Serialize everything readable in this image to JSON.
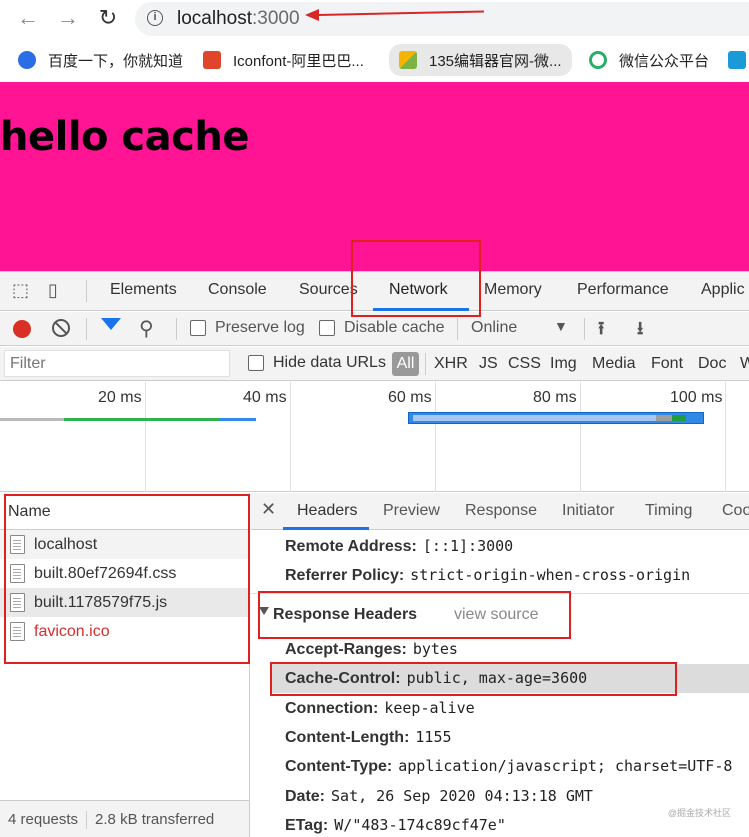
{
  "browser": {
    "url_host": "localhost",
    "url_port": ":3000",
    "bookmarks": [
      {
        "label": "百度一下，你就知道",
        "color": "#2b6de5"
      },
      {
        "label": "Iconfont-阿里巴巴...",
        "color": "#e0452b"
      },
      {
        "label": "135编辑器官网-微...",
        "color": "#f4b400"
      },
      {
        "label": "微信公众平台",
        "color": "#2aae67"
      },
      {
        "label": "",
        "color": "#1a9ad6"
      }
    ]
  },
  "page": {
    "heading": "hello cache",
    "background": "#ff1493"
  },
  "devtools": {
    "tabs": [
      "Elements",
      "Console",
      "Sources",
      "Network",
      "Memory",
      "Performance",
      "Applic"
    ],
    "active_tab": "Network",
    "network_toolbar": {
      "preserve_log": "Preserve log",
      "disable_cache": "Disable cache",
      "throttle": "Online"
    },
    "filter": {
      "placeholder": "Filter",
      "hide_data_urls": "Hide data URLs",
      "all": "All",
      "types": [
        "XHR",
        "JS",
        "CSS",
        "Img",
        "Media",
        "Font",
        "Doc",
        "W"
      ]
    },
    "overview": {
      "ticks": [
        "20 ms",
        "40 ms",
        "60 ms",
        "80 ms",
        "100 ms"
      ]
    },
    "requests": {
      "header": "Name",
      "items": [
        {
          "name": "localhost"
        },
        {
          "name": "built.80ef72694f.css"
        },
        {
          "name": "built.1178579f75.js"
        },
        {
          "name": "favicon.ico"
        }
      ],
      "status_count": "4 requests",
      "status_transfer": "2.8 kB transferred"
    },
    "detail": {
      "tabs": [
        "Headers",
        "Preview",
        "Response",
        "Initiator",
        "Timing",
        "Coo"
      ],
      "active_tab": "Headers",
      "general": [
        {
          "key": "Remote Address:",
          "value": "[::1]:3000"
        },
        {
          "key": "Referrer Policy:",
          "value": "strict-origin-when-cross-origin"
        }
      ],
      "response_headers_title": "Response Headers",
      "view_source": "view source",
      "response_headers": [
        {
          "key": "Accept-Ranges:",
          "value": "bytes"
        },
        {
          "key": "Cache-Control:",
          "value": "public, max-age=3600"
        },
        {
          "key": "Connection:",
          "value": "keep-alive"
        },
        {
          "key": "Content-Length:",
          "value": "1155"
        },
        {
          "key": "Content-Type:",
          "value": "application/javascript; charset=UTF-8"
        },
        {
          "key": "Date:",
          "value": "Sat, 26 Sep 2020 04:13:18 GMT"
        },
        {
          "key": "ETag:",
          "value": "W/\"483-174c89cf47e\""
        }
      ]
    }
  },
  "watermark": "@掘金技术社区",
  "colors": {
    "annotation_red": "#e02020",
    "devtools_accent": "#1a73e8"
  }
}
